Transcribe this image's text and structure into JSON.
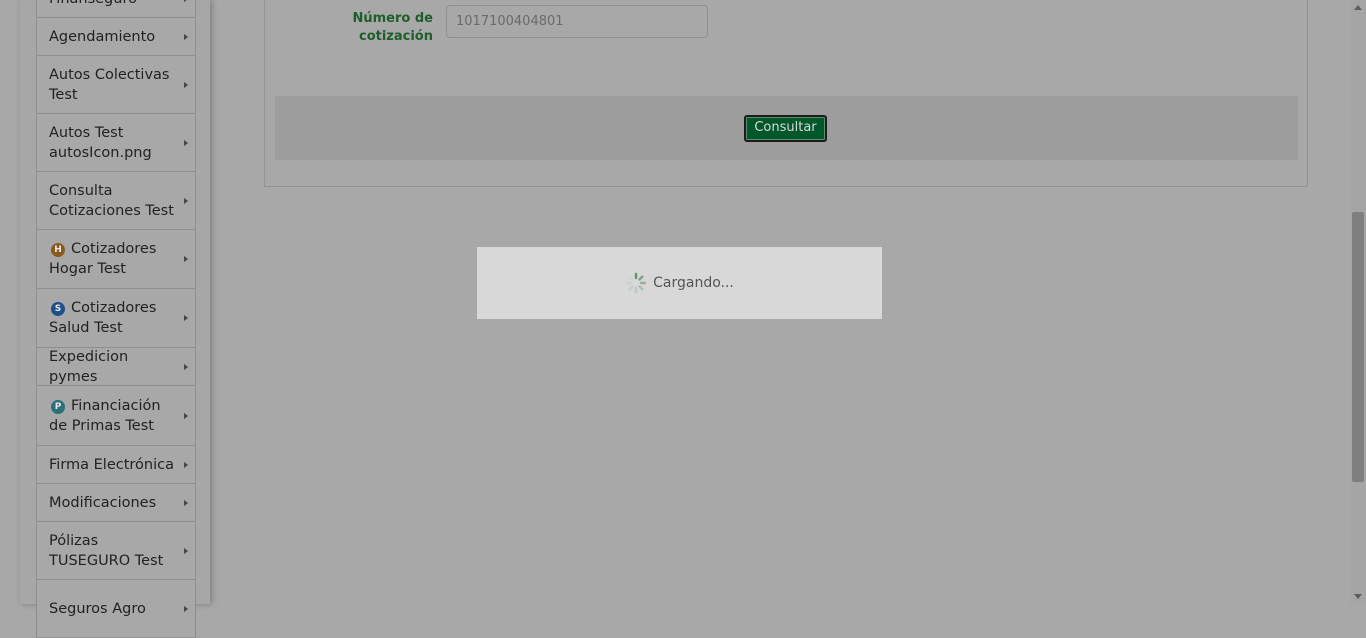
{
  "sidebar": {
    "items": [
      {
        "label": "Finanseguro",
        "badge": null
      },
      {
        "label": "Agendamiento",
        "badge": null
      },
      {
        "label": "Autos Colectivas Test",
        "badge": null
      },
      {
        "label": "Autos Test autosIcon.png",
        "badge": null
      },
      {
        "label": "Consulta Cotizaciones Test",
        "badge": null
      },
      {
        "label": "Cotizadores Hogar Test",
        "badge": "H",
        "badge_color": "#8a5a1c"
      },
      {
        "label": "Cotizadores Salud Test",
        "badge": "S",
        "badge_color": "#1e4f8a"
      },
      {
        "label": "Expedicion pymes",
        "badge": null
      },
      {
        "label": "Financiación de Primas Test",
        "badge": "P",
        "badge_color": "#2b6f79"
      },
      {
        "label": "Firma Electrónica",
        "badge": null
      },
      {
        "label": "Modificaciones",
        "badge": null
      },
      {
        "label": "Pólizas TUSEGURO Test",
        "badge": null
      },
      {
        "label": "Seguros Agro",
        "badge": null
      }
    ]
  },
  "form": {
    "quote_label": "Número de cotización",
    "quote_value": "1017100404801",
    "consult_button": "Consultar"
  },
  "loading": {
    "text": "Cargando..."
  },
  "colors": {
    "accent_green": "#00582a",
    "label_green": "#1d5e2a"
  }
}
